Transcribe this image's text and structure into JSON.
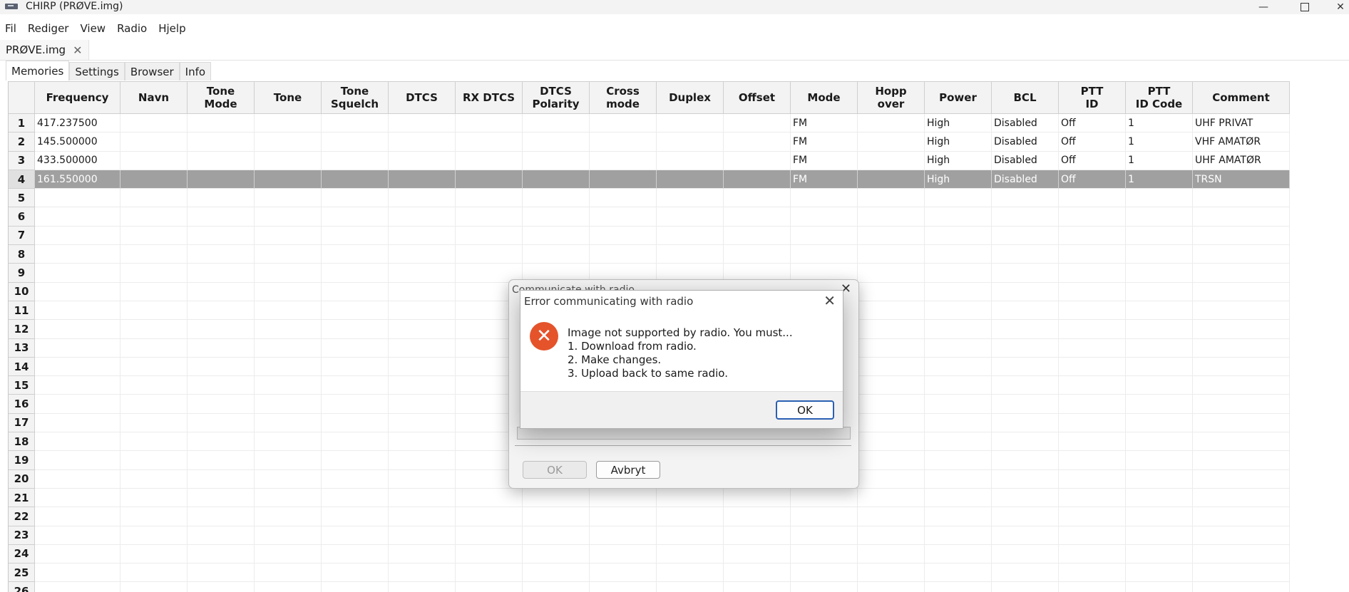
{
  "window": {
    "title": "CHIRP (PRØVE.img)",
    "close_glyph": "✕",
    "minimize_glyph": "—"
  },
  "menu": [
    "Fil",
    "Rediger",
    "View",
    "Radio",
    "Hjelp"
  ],
  "document_tab": {
    "label": "PRØVE.img",
    "close_glyph": "✕"
  },
  "tabs": [
    "Memories",
    "Settings",
    "Browser",
    "Info"
  ],
  "columns": [
    "Frequency",
    "Navn",
    "Tone\nMode",
    "Tone",
    "Tone\nSquelch",
    "DTCS",
    "RX DTCS",
    "DTCS\nPolarity",
    "Cross mode",
    "Duplex",
    "Offset",
    "Mode",
    "Hopp\nover",
    "Power",
    "BCL",
    "PTT\nID",
    "PTT\nID Code",
    "Comment"
  ],
  "rows": [
    {
      "num": "1",
      "frequency": "417.237500",
      "mode": "FM",
      "power": "High",
      "bcl": "Disabled",
      "ptt_id": "Off",
      "ptt_id_code": "1",
      "comment": "UHF PRIVAT"
    },
    {
      "num": "2",
      "frequency": "145.500000",
      "mode": "FM",
      "power": "High",
      "bcl": "Disabled",
      "ptt_id": "Off",
      "ptt_id_code": "1",
      "comment": "VHF AMATØR"
    },
    {
      "num": "3",
      "frequency": "433.500000",
      "mode": "FM",
      "power": "High",
      "bcl": "Disabled",
      "ptt_id": "Off",
      "ptt_id_code": "1",
      "comment": "UHF AMATØR"
    },
    {
      "num": "4",
      "frequency": "161.550000",
      "mode": "FM",
      "power": "High",
      "bcl": "Disabled",
      "ptt_id": "Off",
      "ptt_id_code": "1",
      "comment": "TRSN",
      "selected": true
    }
  ],
  "empty_row_numbers": [
    "5",
    "6",
    "7",
    "8",
    "9",
    "10",
    "11",
    "12",
    "13",
    "14",
    "15",
    "16",
    "17",
    "18",
    "19",
    "20",
    "21",
    "22",
    "23",
    "24",
    "25",
    "26"
  ],
  "comm_dialog": {
    "title": "Communicate with radio",
    "ok_label": "OK",
    "cancel_label": "Avbryt",
    "close_glyph": "✕"
  },
  "error_dialog": {
    "title": "Error communicating with radio",
    "close_glyph": "✕",
    "icon_glyph": "✕",
    "message_lines": [
      "Image not supported by radio. You must...",
      "1. Download from radio.",
      "2. Make changes.",
      "3. Upload back to same radio."
    ],
    "ok_label": "OK"
  }
}
